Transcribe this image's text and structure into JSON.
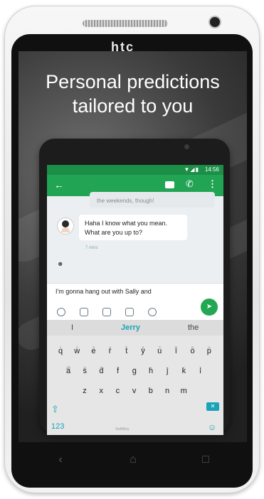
{
  "device": {
    "brand": "htc"
  },
  "promo": {
    "line1": "Personal predictions",
    "line2": "tailored to you"
  },
  "status_bar": {
    "time": "14:56"
  },
  "conversation": {
    "previous_fragment": "the weekends, though!",
    "incoming": {
      "line1": "Haha I know what you mean.",
      "line2": "What are you up to?"
    },
    "timestamp": "7 mins"
  },
  "compose": {
    "text": "I'm gonna hang out with Sally and"
  },
  "keyboard": {
    "predictions": [
      "I",
      "Jerry",
      "the"
    ],
    "rows": [
      [
        {
          "k": "q",
          "h": "1"
        },
        {
          "k": "w",
          "h": "2"
        },
        {
          "k": "e",
          "h": "3"
        },
        {
          "k": "r",
          "h": "4"
        },
        {
          "k": "t",
          "h": "5"
        },
        {
          "k": "y",
          "h": "6"
        },
        {
          "k": "u",
          "h": "7"
        },
        {
          "k": "i",
          "h": "8"
        },
        {
          "k": "o",
          "h": "9"
        },
        {
          "k": "p",
          "h": "0"
        }
      ],
      [
        {
          "k": "a",
          "h": "@"
        },
        {
          "k": "s",
          "h": "#"
        },
        {
          "k": "d",
          "h": "&"
        },
        {
          "k": "f",
          "h": "*"
        },
        {
          "k": "g",
          "h": "-"
        },
        {
          "k": "h",
          "h": "+"
        },
        {
          "k": "j",
          "h": "="
        },
        {
          "k": "k",
          "h": "("
        },
        {
          "k": "l",
          "h": ")"
        }
      ],
      [
        {
          "k": "z",
          "h": ""
        },
        {
          "k": "x",
          "h": ""
        },
        {
          "k": "c",
          "h": ""
        },
        {
          "k": "v",
          "h": ""
        },
        {
          "k": "b",
          "h": ""
        },
        {
          "k": "n",
          "h": ""
        },
        {
          "k": "m",
          "h": ""
        }
      ]
    ],
    "numbers_key": "123",
    "space_label": "SwiftKey"
  },
  "colors": {
    "app_green": "#21a454",
    "status_green": "#1b8f47",
    "prediction_accent": "#1aa3b8"
  }
}
